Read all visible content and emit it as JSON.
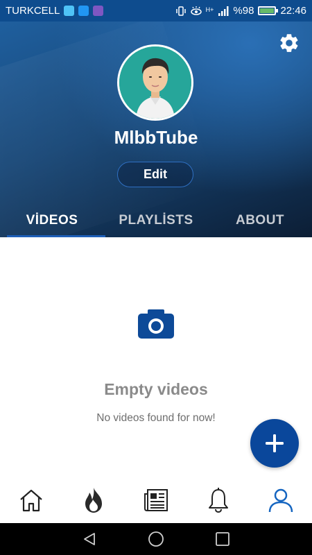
{
  "status_bar": {
    "carrier": "TURKCELL",
    "signal_label": "H+",
    "battery": "%98",
    "battery_level": 0.98,
    "time": "22:46"
  },
  "profile": {
    "channel_name": "MlbbTube",
    "edit_label": "Edit"
  },
  "tabs": [
    {
      "label": "VİDEOS",
      "active": true
    },
    {
      "label": "PLAYLİSTS",
      "active": false
    },
    {
      "label": "ABOUT",
      "active": false
    }
  ],
  "empty_state": {
    "title": "Empty videos",
    "subtitle": "No videos found for now!"
  },
  "bottom_nav": [
    {
      "icon": "home-icon",
      "active": false
    },
    {
      "icon": "fire-icon",
      "active": false
    },
    {
      "icon": "news-icon",
      "active": false
    },
    {
      "icon": "bell-icon",
      "active": false
    },
    {
      "icon": "profile-icon",
      "active": true
    }
  ],
  "system_nav": [
    "back-icon",
    "home-circle-icon",
    "recents-icon"
  ],
  "colors": {
    "accent": "#0a479b",
    "active_nav": "#1565c0",
    "status_bar": "#0e4c8e"
  }
}
